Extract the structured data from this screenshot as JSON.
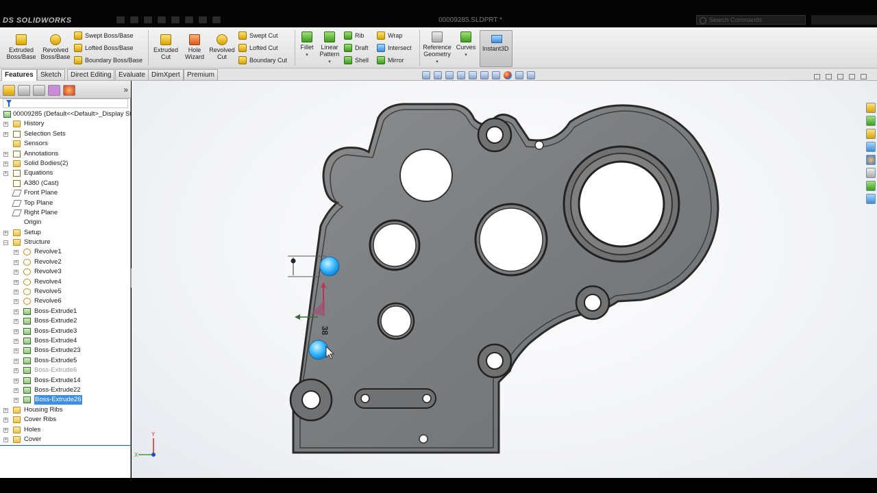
{
  "app": {
    "logo_text": "DS SOLIDWORKS",
    "doc_title": "00009285.SLDPRT *",
    "search_placeholder": "Search Commands"
  },
  "ribbon": {
    "extruded_boss": "Extruded\nBoss/Base",
    "revolved_boss": "Revolved\nBoss/Base",
    "swept_boss": "Swept Boss/Base",
    "lofted_boss": "Lofted Boss/Base",
    "boundary_boss": "Boundary Boss/Base",
    "extruded_cut": "Extruded\nCut",
    "hole_wizard": "Hole\nWizard",
    "revolved_cut": "Revolved\nCut",
    "swept_cut": "Swept Cut",
    "lofted_cut": "Lofted Cut",
    "boundary_cut": "Boundary Cut",
    "fillet": "Fillet",
    "linear_pattern": "Linear\nPattern",
    "rib": "Rib",
    "draft": "Draft",
    "shell": "Shell",
    "wrap": "Wrap",
    "intersect": "Intersect",
    "mirror": "Mirror",
    "reference_geometry": "Reference\nGeometry",
    "curves": "Curves",
    "instant3d": "Instant3D"
  },
  "tabs": [
    "Features",
    "Sketch",
    "Direct Editing",
    "Evaluate",
    "DimXpert",
    "Premium"
  ],
  "tree": {
    "root": "00009285  (Default<<Default>_Display St",
    "items": [
      {
        "label": "History",
        "icon": "history",
        "level": 0,
        "expand": "+"
      },
      {
        "label": "Selection Sets",
        "icon": "selection-sets",
        "level": 0,
        "expand": "+"
      },
      {
        "label": "Sensors",
        "icon": "sensors",
        "level": 0,
        "expand": ""
      },
      {
        "label": "Annotations",
        "icon": "annotations",
        "level": 0,
        "expand": "+"
      },
      {
        "label": "Solid Bodies(2)",
        "icon": "solid-bodies",
        "level": 0,
        "expand": "+"
      },
      {
        "label": "Equations",
        "icon": "equations",
        "level": 0,
        "expand": "+"
      },
      {
        "label": "A380 (Cast)",
        "icon": "material",
        "level": 0,
        "expand": ""
      },
      {
        "label": "Front Plane",
        "icon": "plane",
        "level": 0,
        "expand": ""
      },
      {
        "label": "Top Plane",
        "icon": "plane",
        "level": 0,
        "expand": ""
      },
      {
        "label": "Right Plane",
        "icon": "plane",
        "level": 0,
        "expand": ""
      },
      {
        "label": "Origin",
        "icon": "origin",
        "level": 0,
        "expand": ""
      },
      {
        "label": "Setup",
        "icon": "folder",
        "level": 0,
        "expand": "+"
      },
      {
        "label": "Structure",
        "icon": "folder",
        "level": 0,
        "expand": "-"
      },
      {
        "label": "Revolve1",
        "icon": "revolve",
        "level": 1,
        "expand": "+"
      },
      {
        "label": "Revolve2",
        "icon": "revolve",
        "level": 1,
        "expand": "+"
      },
      {
        "label": "Revolve3",
        "icon": "revolve",
        "level": 1,
        "expand": "+"
      },
      {
        "label": "Revolve4",
        "icon": "revolve",
        "level": 1,
        "expand": "+"
      },
      {
        "label": "Revolve5",
        "icon": "revolve",
        "level": 1,
        "expand": "+"
      },
      {
        "label": "Revolve6",
        "icon": "revolve",
        "level": 1,
        "expand": "+"
      },
      {
        "label": "Boss-Extrude1",
        "icon": "extrude",
        "level": 1,
        "expand": "+"
      },
      {
        "label": "Boss-Extrude2",
        "icon": "extrude",
        "level": 1,
        "expand": "+"
      },
      {
        "label": "Boss-Extrude3",
        "icon": "extrude",
        "level": 1,
        "expand": "+"
      },
      {
        "label": "Boss-Extrude4",
        "icon": "extrude",
        "level": 1,
        "expand": "+"
      },
      {
        "label": "Boss-Extrude23",
        "icon": "extrude",
        "level": 1,
        "expand": "+"
      },
      {
        "label": "Boss-Extrude5",
        "icon": "extrude",
        "level": 1,
        "expand": "+"
      },
      {
        "label": "Boss-Extrude6",
        "icon": "extrude",
        "level": 1,
        "expand": "+",
        "state": "dim"
      },
      {
        "label": "Boss-Extrude14",
        "icon": "extrude",
        "level": 1,
        "expand": "+"
      },
      {
        "label": "Boss-Extrude22",
        "icon": "extrude",
        "level": 1,
        "expand": "+"
      },
      {
        "label": "Boss-Extrude26",
        "icon": "extrude",
        "level": 1,
        "expand": "+",
        "state": "selected"
      },
      {
        "label": "Housing Ribs",
        "icon": "folder",
        "level": 0,
        "expand": "+"
      },
      {
        "label": "Cover Ribs",
        "icon": "folder",
        "level": 0,
        "expand": "+"
      },
      {
        "label": "Holes",
        "icon": "folder",
        "level": 0,
        "expand": "+"
      },
      {
        "label": "Cover",
        "icon": "folder",
        "level": 0,
        "expand": "+"
      }
    ]
  },
  "viewport": {
    "dimension_value": "38",
    "triad_x": "X",
    "triad_y": "Y"
  },
  "colors": {
    "part_fill": "#7d7f81",
    "selection_blue": "#3d8ee6",
    "handle_cyan": "#35b6ff"
  }
}
